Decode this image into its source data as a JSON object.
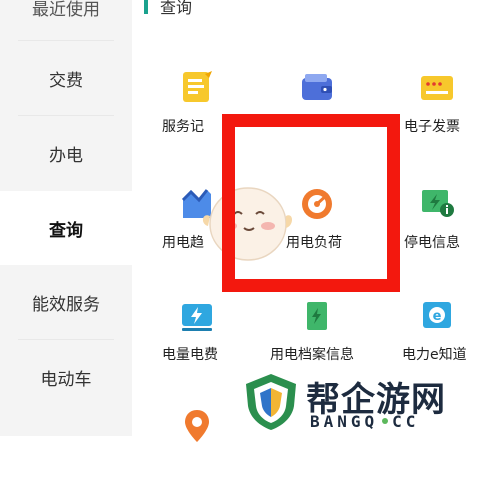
{
  "sidebar": {
    "items": [
      {
        "label": "最近使用"
      },
      {
        "label": "交费"
      },
      {
        "label": "办电"
      },
      {
        "label": "查询"
      },
      {
        "label": "能效服务"
      },
      {
        "label": "电动车"
      }
    ],
    "active": "查询"
  },
  "section": {
    "title": "查询"
  },
  "tiles": [
    {
      "label": "服务记录",
      "icon": "service-record-icon"
    },
    {
      "label": "wallet",
      "icon": "wallet-icon"
    },
    {
      "label": "电子发票",
      "icon": "invoice-icon"
    },
    {
      "label": "用电趋势",
      "icon": "trend-icon"
    },
    {
      "label": "用电负荷",
      "icon": "load-gauge-icon"
    },
    {
      "label": "停电信息",
      "icon": "outage-icon"
    },
    {
      "label": "电量电费",
      "icon": "energy-bill-icon"
    },
    {
      "label": "用电档案信息",
      "icon": "archive-icon"
    },
    {
      "label": "电力e知道",
      "icon": "knowledge-icon"
    },
    {
      "label": "",
      "icon": "location-icon"
    }
  ],
  "visible_labels": {
    "t1": "服务记",
    "t3": "电子发票",
    "t4": "用电趋",
    "t5": "用电负荷",
    "t6": "停电信息",
    "t7": "电量电费",
    "t8": "用电档案信息",
    "t9": "电力e知道"
  },
  "watermark": {
    "cn": "帮企游网",
    "en_left": "BANGQ",
    "en_right": "CC"
  },
  "colors": {
    "accent": "#1aa28e",
    "highlight": "#f3180e",
    "brand_dark": "#1d2b3f"
  }
}
